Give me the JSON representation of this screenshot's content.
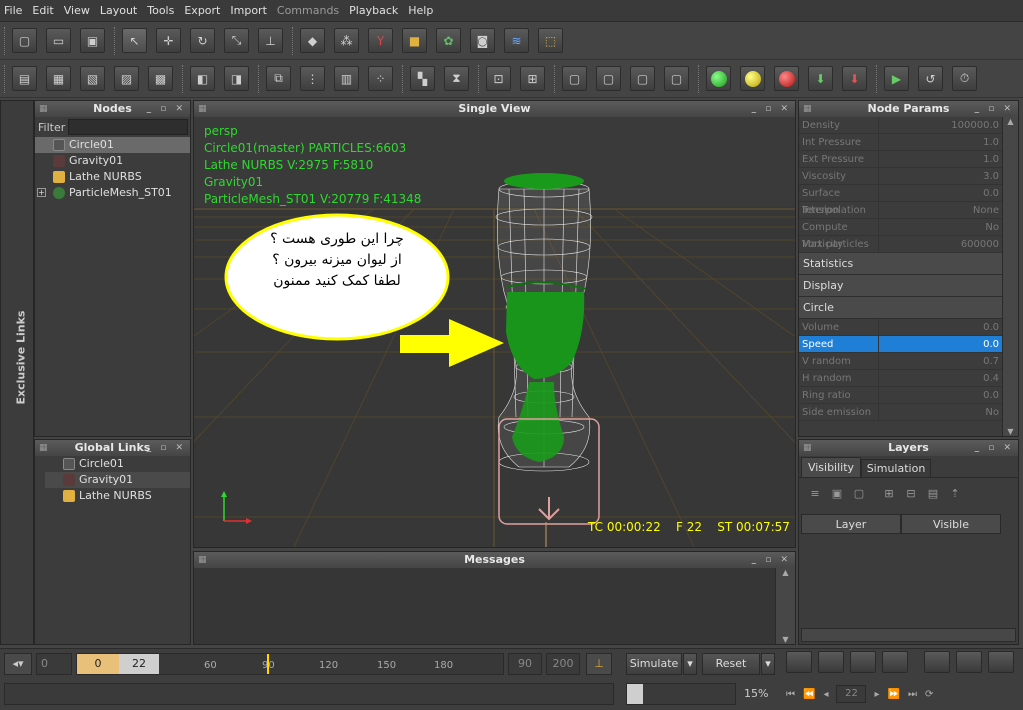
{
  "menu": [
    "File",
    "Edit",
    "View",
    "Layout",
    "Tools",
    "Export",
    "Import",
    "Commands",
    "Playback",
    "Help"
  ],
  "panels": {
    "nodes": "Nodes",
    "single_view": "Single View",
    "node_params": "Node Params",
    "global_links": "Global Links",
    "messages": "Messages",
    "layers": "Layers",
    "exclusive_links": "Exclusive Links"
  },
  "filter_label": "Filter",
  "nodes": [
    "Circle01",
    "Gravity01",
    "Lathe NURBS",
    "ParticleMesh_ST01"
  ],
  "global_links": [
    "Circle01",
    "Gravity01",
    "Lathe NURBS"
  ],
  "viewport": {
    "camera": "persp",
    "info": [
      "Circle01(master) PARTICLES:6603",
      "Lathe NURBS V:2975 F:5810",
      "Gravity01",
      "ParticleMesh_ST01 V:20779 F:41348"
    ],
    "annotation": [
      "چرا این طوری هست ؟",
      "از لیوان میزنه بیرون ؟",
      "لطفا کمک کنید ممنون"
    ],
    "timecode": "TC 00:00:22",
    "frame": "F 22",
    "simtime": "ST 00:07:57"
  },
  "params": [
    {
      "k": "Density",
      "v": "100000.0"
    },
    {
      "k": "Int Pressure",
      "v": "1.0"
    },
    {
      "k": "Ext Pressure",
      "v": "1.0"
    },
    {
      "k": "Viscosity",
      "v": "3.0"
    },
    {
      "k": "Surface Tension",
      "v": "0.0"
    },
    {
      "k": "Interpolation",
      "v": "None"
    },
    {
      "k": "Compute Vorticity",
      "v": "No"
    },
    {
      "k": "Max particles",
      "v": "600000"
    }
  ],
  "sections": [
    "Statistics",
    "Display",
    "Circle"
  ],
  "circle_params": [
    {
      "k": "Volume",
      "v": "0.0"
    },
    {
      "k": "Speed",
      "v": "0.0"
    },
    {
      "k": "V random",
      "v": "0.7"
    },
    {
      "k": "H random",
      "v": "0.4"
    },
    {
      "k": "Ring ratio",
      "v": "0.0"
    },
    {
      "k": "Side emission",
      "v": "No"
    }
  ],
  "layers": {
    "tabs": [
      "Visibility",
      "Simulation"
    ],
    "columns": [
      "Layer",
      "Visible"
    ]
  },
  "timeline": {
    "start": "0",
    "current_start": "0",
    "current": "22",
    "ticks": [
      "60",
      "90",
      "120",
      "150",
      "180"
    ],
    "end1": "90",
    "end2": "200",
    "simulate": "Simulate",
    "reset": "Reset",
    "progress": "15%",
    "frame_field": "22",
    "progress_value": 0.15
  },
  "colors": {
    "accent": "#1f7fd6",
    "viewport_text": "#2fd92f",
    "timeline_current": "#e8c07a",
    "annotation": "#ffff00"
  }
}
